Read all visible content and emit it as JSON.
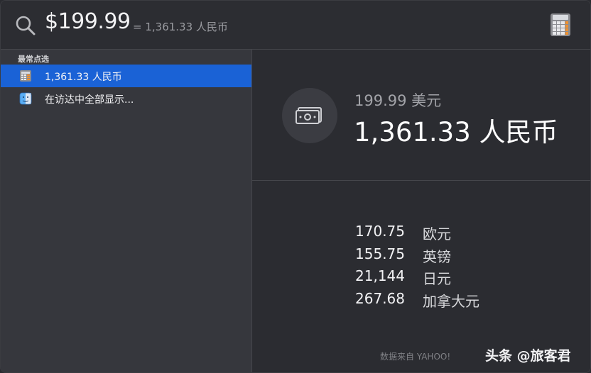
{
  "search": {
    "query": "$199.99",
    "inline_result": "= 1,361.33 人民币"
  },
  "sidebar": {
    "section_header": "最常点选",
    "items": [
      {
        "label": "1,361.33 人民币",
        "icon": "calculator-icon",
        "selected": true
      },
      {
        "label": "在访达中全部显示...",
        "icon": "finder-icon",
        "selected": false
      }
    ]
  },
  "detail": {
    "source_amount": "199.99 美元",
    "result_amount": "1,361.33 人民币",
    "rates": [
      {
        "value": "170.75",
        "currency": "欧元"
      },
      {
        "value": "155.75",
        "currency": "英镑"
      },
      {
        "value": "21,144",
        "currency": "日元"
      },
      {
        "value": "267.68",
        "currency": "加拿大元"
      }
    ],
    "source_credit": "数据来自 YAHOO!"
  },
  "watermark": "头条 @旅客君",
  "colors": {
    "selection": "#1a62d6",
    "background": "#2b2c31",
    "sidebar": "#36373d"
  }
}
